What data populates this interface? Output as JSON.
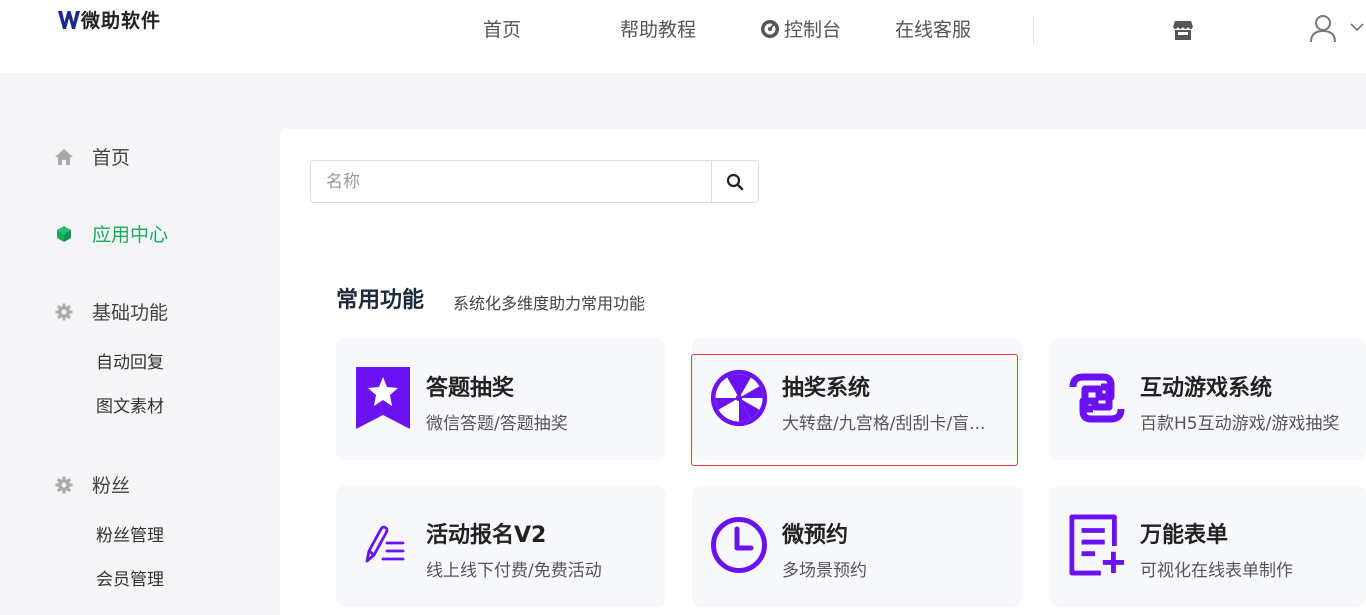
{
  "header": {
    "logo_text": "微助软件",
    "nav": [
      "首页",
      "帮助教程",
      "控制台",
      "在线客服"
    ]
  },
  "sidebar": {
    "items": [
      {
        "label": "首页",
        "icon": "home-icon"
      },
      {
        "label": "应用中心",
        "icon": "cube-icon",
        "active": true
      },
      {
        "label": "基础功能",
        "icon": "gear-icon",
        "children": [
          "自动回复",
          "图文素材"
        ]
      },
      {
        "label": "粉丝",
        "icon": "gear-icon",
        "children": [
          "粉丝管理",
          "会员管理"
        ]
      }
    ]
  },
  "search": {
    "placeholder": "名称",
    "value": ""
  },
  "section": {
    "title": "常用功能",
    "subtitle": "系统化多维度助力常用功能"
  },
  "cards": [
    {
      "title": "答题抽奖",
      "desc": "微信答题/答题抽奖",
      "icon": "ribbon-star-icon"
    },
    {
      "title": "抽奖系统",
      "desc": "大转盘/九宫格/刮刮卡/盲...",
      "icon": "wheel-icon",
      "selected": true
    },
    {
      "title": "互动游戏系统",
      "desc": "百款H5互动游戏/游戏抽奖",
      "icon": "game-link-icon"
    },
    {
      "title": "活动报名V2",
      "desc": "线上线下付费/免费活动",
      "icon": "pen-list-icon"
    },
    {
      "title": "微预约",
      "desc": "多场景预约",
      "icon": "clock-icon"
    },
    {
      "title": "万能表单",
      "desc": "可视化在线表单制作",
      "icon": "form-add-icon"
    }
  ],
  "colors": {
    "accent_green": "#1aaa5f",
    "brand_purple": "#6a12f2",
    "selected_border": "#e23b3b"
  }
}
